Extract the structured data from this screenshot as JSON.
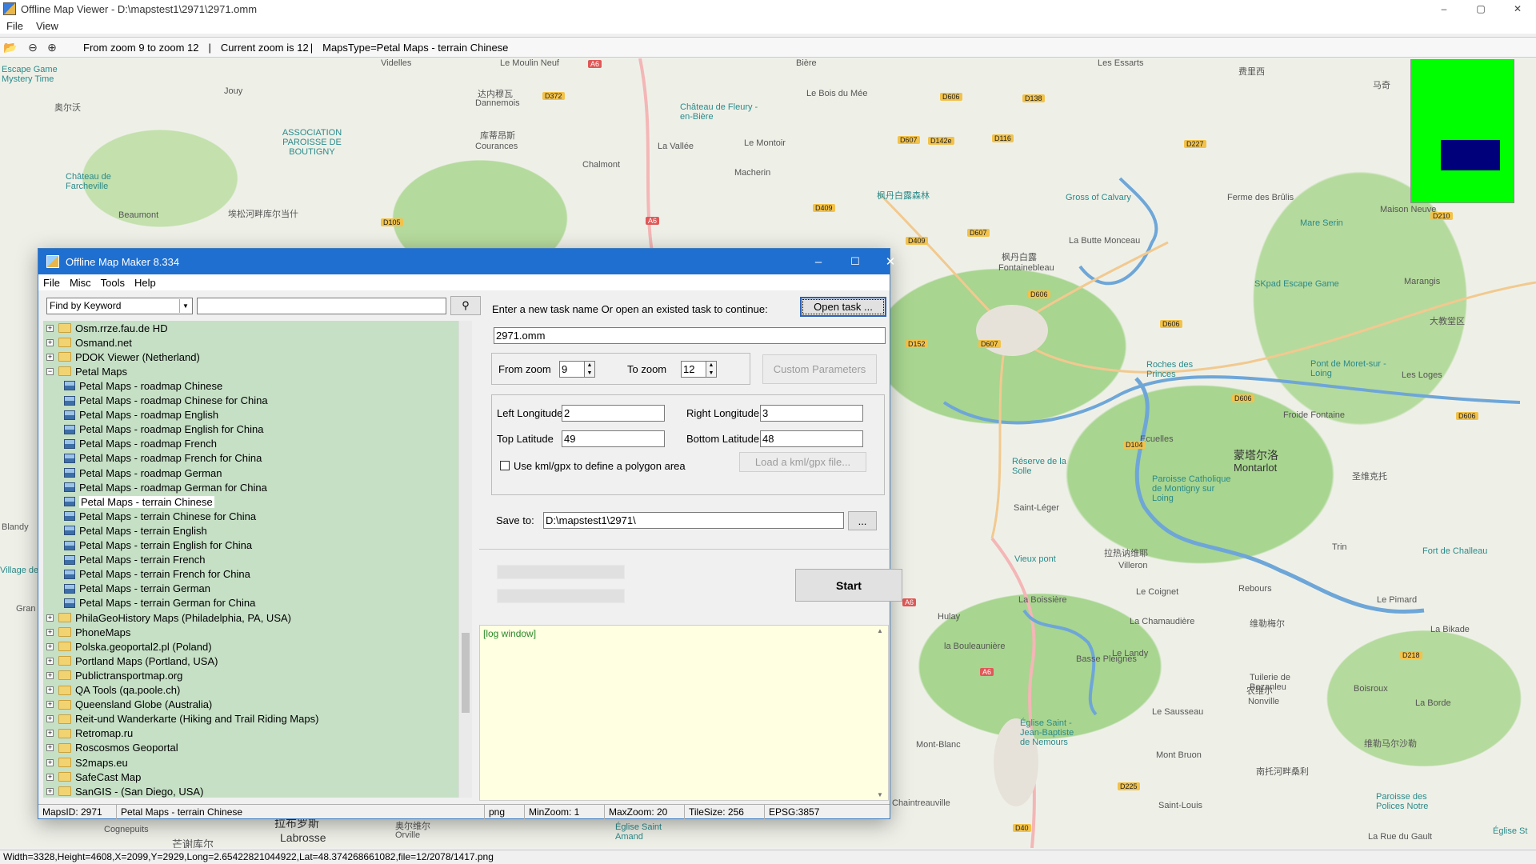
{
  "viewer": {
    "title": "Offline Map Viewer - D:\\mapstest1\\2971\\2971.omm",
    "menu": [
      "File",
      "View"
    ],
    "toolbar_info": {
      "zoom_range": "From zoom 9 to zoom 12",
      "sep1": "|",
      "current_zoom": "Current zoom is 12",
      "sep2": "|",
      "maps_type": "MapsType=Petal Maps - terrain Chinese"
    },
    "status": "Width=3328,Height=4608,X=2099,Y=2929,Long=2.65422821044922,Lat=48.374268661082,file=12/2078/1417.png",
    "window_controls": [
      "–",
      "▢",
      "✕"
    ]
  },
  "map_labels": [
    {
      "text": "Escape Game Mystery Time",
      "kind": "poi"
    },
    {
      "text": "Videlles",
      "kind": "town"
    },
    {
      "text": "Le Moulin Neuf",
      "kind": "town"
    },
    {
      "text": "Bière",
      "kind": "town"
    },
    {
      "text": "Les Essarts",
      "kind": "town"
    },
    {
      "text": "费里西",
      "kind": "town"
    },
    {
      "text": "马奇",
      "kind": "town"
    },
    {
      "text": "Jouy",
      "kind": "town"
    },
    {
      "text": "达内穆瓦",
      "kind": "town"
    },
    {
      "text": "Dannemois",
      "kind": "town"
    },
    {
      "text": "Château de Fleury -en-Bière",
      "kind": "poi"
    },
    {
      "text": "Le Bois du Mée",
      "kind": "town"
    },
    {
      "text": "奥尔沃",
      "kind": "town"
    },
    {
      "text": "ASSOCIATION PAROISSE DE BOUTIGNY",
      "kind": "poi"
    },
    {
      "text": "库蒂昂斯",
      "kind": "town"
    },
    {
      "text": "Courances",
      "kind": "town"
    },
    {
      "text": "La Vallée",
      "kind": "town"
    },
    {
      "text": "Le Montoir",
      "kind": "town"
    },
    {
      "text": "Chalmont",
      "kind": "town"
    },
    {
      "text": "Macherin",
      "kind": "town"
    },
    {
      "text": "Château de Farcheville",
      "kind": "poi"
    },
    {
      "text": "Beaumont",
      "kind": "town"
    },
    {
      "text": "埃松河畔库尔当什",
      "kind": "town"
    },
    {
      "text": "枫丹白露森林",
      "kind": "poi"
    },
    {
      "text": "Gross of Calvary",
      "kind": "poi"
    },
    {
      "text": "Ferme des Brûlis",
      "kind": "town"
    },
    {
      "text": "Maison Neuve",
      "kind": "town"
    },
    {
      "text": "Mare Serin",
      "kind": "poi"
    },
    {
      "text": "枫丹白露",
      "kind": "big"
    },
    {
      "text": "Fontainebleau",
      "kind": "town"
    },
    {
      "text": "La Butte Monceau",
      "kind": "town"
    },
    {
      "text": "SKpad Escape Game",
      "kind": "poi"
    },
    {
      "text": "Marangis",
      "kind": "town"
    },
    {
      "text": "大教堂区",
      "kind": "town"
    },
    {
      "text": "Roches des Princes",
      "kind": "poi"
    },
    {
      "text": "Pont de Moret-sur -Loing",
      "kind": "poi"
    },
    {
      "text": "Les Loges",
      "kind": "town"
    },
    {
      "text": "Froide Fontaine",
      "kind": "town"
    },
    {
      "text": "Ecuelles",
      "kind": "town"
    },
    {
      "text": "蒙塔尔洛",
      "kind": "big"
    },
    {
      "text": "Montarlot",
      "kind": "big"
    },
    {
      "text": "圣维克托",
      "kind": "town"
    },
    {
      "text": "Réserve de la Solle",
      "kind": "poi"
    },
    {
      "text": "Paroisse Catholique de Montigny sur Loing",
      "kind": "poi"
    },
    {
      "text": "Saint-Léger",
      "kind": "town"
    },
    {
      "text": "拉热讷维耶",
      "kind": "town"
    },
    {
      "text": "Vieux pont",
      "kind": "poi"
    },
    {
      "text": "Villeron",
      "kind": "town"
    },
    {
      "text": "Fort de Challeau",
      "kind": "poi"
    },
    {
      "text": "Trin",
      "kind": "town"
    },
    {
      "text": "La Boissière",
      "kind": "town"
    },
    {
      "text": "Le Coignet",
      "kind": "town"
    },
    {
      "text": "Rebours",
      "kind": "town"
    },
    {
      "text": "Le Pimard",
      "kind": "town"
    },
    {
      "text": "La Chamaudière",
      "kind": "town"
    },
    {
      "text": "维勒梅尔",
      "kind": "town"
    },
    {
      "text": "La Bikade",
      "kind": "town"
    },
    {
      "text": "Hulay",
      "kind": "town"
    },
    {
      "text": "la Bouleaunière",
      "kind": "town"
    },
    {
      "text": "Le Landy",
      "kind": "town"
    },
    {
      "text": "Basse Pleignes",
      "kind": "town"
    },
    {
      "text": "农维尔",
      "kind": "town"
    },
    {
      "text": "Nonville",
      "kind": "town"
    },
    {
      "text": "Boisroux",
      "kind": "town"
    },
    {
      "text": "Tuilerie de Bezanleu",
      "kind": "town"
    },
    {
      "text": "La Borde",
      "kind": "town"
    },
    {
      "text": "Le Sausseau",
      "kind": "town"
    },
    {
      "text": "Église Saint -Jean-Baptiste de Nemours",
      "kind": "poi"
    },
    {
      "text": "Mont-Blanc",
      "kind": "town"
    },
    {
      "text": "维勒马尔沙勒",
      "kind": "town"
    },
    {
      "text": "Mont Bruon",
      "kind": "town"
    },
    {
      "text": "南托河畔桑利",
      "kind": "town"
    },
    {
      "text": "Paroisse des Polices Notre",
      "kind": "poi"
    },
    {
      "text": "Saint-Louis",
      "kind": "town"
    },
    {
      "text": "Chaintreauville",
      "kind": "town"
    },
    {
      "text": "Église Saint Amand",
      "kind": "poi"
    },
    {
      "text": "Église St",
      "kind": "poi"
    },
    {
      "text": "La Rue du Gault",
      "kind": "town"
    },
    {
      "text": "Labrosse",
      "kind": "big"
    },
    {
      "text": "拉布罗斯",
      "kind": "big"
    },
    {
      "text": "芒谢库尔",
      "kind": "town"
    },
    {
      "text": "Cognepuits",
      "kind": "town"
    },
    {
      "text": "奥尔维尔",
      "kind": "town"
    },
    {
      "text": "Orville",
      "kind": "town"
    },
    {
      "text": "Blandy",
      "kind": "town"
    },
    {
      "text": "Village de",
      "kind": "poi"
    },
    {
      "text": "Gran",
      "kind": "town"
    }
  ],
  "road_badges": [
    "A6",
    "D372",
    "D606",
    "D138",
    "D116",
    "D227",
    "D607",
    "D142e",
    "D409",
    "D105",
    "A6",
    "D409",
    "D607",
    "D606",
    "D210",
    "D152",
    "D606",
    "D607",
    "D606",
    "D104",
    "D606",
    "A6",
    "A6",
    "D218",
    "D225",
    "D40"
  ],
  "maker": {
    "title": "Offline Map Maker 8.334",
    "menu": [
      "File",
      "Misc",
      "Tools",
      "Help"
    ],
    "search": {
      "mode": "Find by Keyword",
      "value": ""
    },
    "tree": [
      {
        "label": "Osm.rrze.fau.de HD",
        "type": "folder",
        "expanded": false
      },
      {
        "label": "Osmand.net",
        "type": "folder",
        "expanded": false
      },
      {
        "label": "PDOK Viewer (Netherland)",
        "type": "folder",
        "expanded": false
      },
      {
        "label": "Petal Maps",
        "type": "folder",
        "expanded": true
      },
      {
        "label": "Petal Maps - roadmap Chinese",
        "type": "map"
      },
      {
        "label": "Petal Maps - roadmap Chinese for China",
        "type": "map"
      },
      {
        "label": "Petal Maps - roadmap English",
        "type": "map"
      },
      {
        "label": "Petal Maps - roadmap English for China",
        "type": "map"
      },
      {
        "label": "Petal Maps - roadmap French",
        "type": "map"
      },
      {
        "label": "Petal Maps - roadmap French for China",
        "type": "map"
      },
      {
        "label": "Petal Maps - roadmap German",
        "type": "map"
      },
      {
        "label": "Petal Maps - roadmap German for China",
        "type": "map"
      },
      {
        "label": "Petal Maps - terrain Chinese",
        "type": "map",
        "selected": true
      },
      {
        "label": "Petal Maps - terrain Chinese for China",
        "type": "map"
      },
      {
        "label": "Petal Maps - terrain English",
        "type": "map"
      },
      {
        "label": "Petal Maps - terrain English for China",
        "type": "map"
      },
      {
        "label": "Petal Maps - terrain French",
        "type": "map"
      },
      {
        "label": "Petal Maps - terrain French for China",
        "type": "map"
      },
      {
        "label": "Petal Maps - terrain German",
        "type": "map"
      },
      {
        "label": "Petal Maps - terrain German for China",
        "type": "map"
      },
      {
        "label": "PhilaGeoHistory Maps (Philadelphia, PA, USA)",
        "type": "folder",
        "expanded": false
      },
      {
        "label": "PhoneMaps",
        "type": "folder",
        "expanded": false
      },
      {
        "label": "Polska.geoportal2.pl (Poland)",
        "type": "folder",
        "expanded": false
      },
      {
        "label": "Portland Maps (Portland, USA)",
        "type": "folder",
        "expanded": false
      },
      {
        "label": "Publictransportmap.org",
        "type": "folder",
        "expanded": false
      },
      {
        "label": "QA Tools (qa.poole.ch)",
        "type": "folder",
        "expanded": false
      },
      {
        "label": "Queensland Globe (Australia)",
        "type": "folder",
        "expanded": false
      },
      {
        "label": "Reit-und Wanderkarte (Hiking and Trail Riding Maps)",
        "type": "folder",
        "expanded": false
      },
      {
        "label": "Retromap.ru",
        "type": "folder",
        "expanded": false
      },
      {
        "label": "Roscosmos Geoportal",
        "type": "folder",
        "expanded": false
      },
      {
        "label": "S2maps.eu",
        "type": "folder",
        "expanded": false
      },
      {
        "label": "SafeCast Map",
        "type": "folder",
        "expanded": false
      },
      {
        "label": "SanGIS - (San Diego, USA)",
        "type": "folder",
        "expanded": false
      }
    ],
    "task": {
      "prompt": "Enter a new task name Or open an existed task to continue:",
      "open_button": "Open task ...",
      "task_name": "2971.omm",
      "from_zoom_label": "From zoom",
      "from_zoom": "9",
      "to_zoom_label": "To zoom",
      "to_zoom": "12",
      "custom_params": "Custom Parameters",
      "left_lon_label": "Left Longitude",
      "left_lon": "2",
      "right_lon_label": "Right Longitude",
      "right_lon": "3",
      "top_lat_label": "Top Latitude",
      "top_lat": "49",
      "bottom_lat_label": "Bottom Latitude",
      "bottom_lat": "48",
      "kml_label": "Use kml/gpx to define a polygon area",
      "kml_checked": false,
      "load_kml": "Load a kml/gpx file...",
      "save_label": "Save to:",
      "save_path": "D:\\mapstest1\\2971\\",
      "browse": "...",
      "start": "Start",
      "log": "[log window]"
    },
    "status": {
      "maps_id": "MapsID: 2971",
      "map_name": "Petal Maps - terrain Chinese",
      "format": "png",
      "min_zoom": "MinZoom: 1",
      "max_zoom": "MaxZoom: 20",
      "tile_size": "TileSize: 256",
      "epsg": "EPSG:3857"
    },
    "window_controls": [
      "–",
      "☐",
      "✕"
    ]
  }
}
